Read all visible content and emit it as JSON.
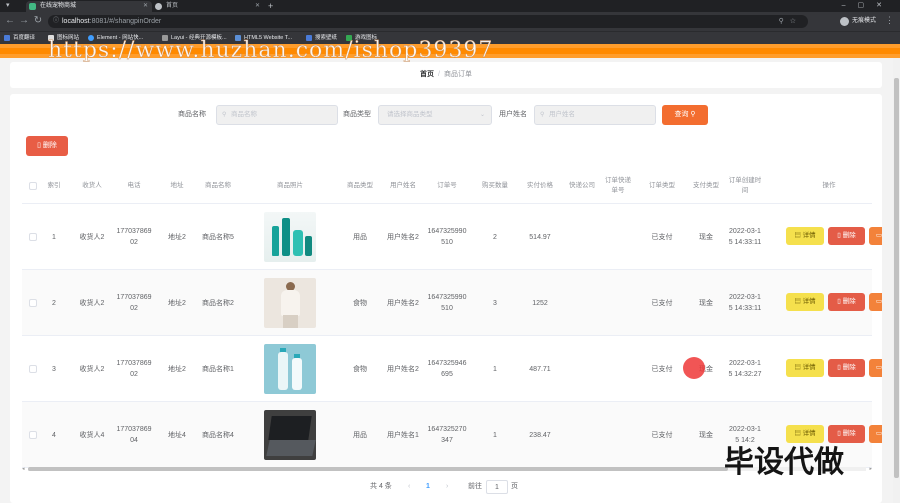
{
  "browser": {
    "tabs": [
      {
        "title": "在线宠物商城",
        "active": true
      },
      {
        "title": "首页",
        "active": false
      }
    ],
    "url_host": "localhost",
    "url_path": ":8081/#/shangpinOrder",
    "profile_label": "无痕模式",
    "bookmarks": [
      "百度翻译",
      "图标网站",
      "Element - 网站快...",
      "Layui - 经典开源模板...",
      "HTML5 Website T...",
      "搜索壁纸",
      "游戏图标"
    ]
  },
  "watermark": "https://www.huzhan.com/ishop39397",
  "breadcrumb": {
    "home": "首页",
    "separator": "/",
    "current": "商品订单"
  },
  "filters": {
    "product_name_label": "商品名称",
    "product_name_placeholder": "商品名称",
    "product_type_label": "商品类型",
    "product_type_placeholder": "请选择商品类型",
    "user_name_label": "用户姓名",
    "user_name_placeholder": "用户姓名",
    "search_button": "查询"
  },
  "actions": {
    "delete_button": "删除"
  },
  "table": {
    "columns": [
      "索引",
      "收货人",
      "电话",
      "地址",
      "商品名称",
      "商品照片",
      "商品类型",
      "用户姓名",
      "订单号",
      "购买数量",
      "实付价格",
      "快递公司",
      "订单快递单号",
      "订单类型",
      "支付类型",
      "订单创建时间",
      "操作"
    ],
    "rows": [
      {
        "index": "1",
        "receiver": "收货人2",
        "phone": "17703786902",
        "address": "地址2",
        "product_name": "商品名称5",
        "type": "用品",
        "user": "用户姓名2",
        "order_no": "1647325990510",
        "qty": "2",
        "price": "514.97",
        "courier": "",
        "tracking": "",
        "order_type": "已支付",
        "pay_type": "现金",
        "created": "2022-03-15 14:33:11",
        "image": "cosmetics-bottles"
      },
      {
        "index": "2",
        "receiver": "收货人2",
        "phone": "17703786902",
        "address": "地址2",
        "product_name": "商品名称2",
        "type": "食物",
        "user": "用户姓名2",
        "order_no": "1647325990510",
        "qty": "3",
        "price": "1252",
        "courier": "",
        "tracking": "",
        "order_type": "已支付",
        "pay_type": "现金",
        "created": "2022-03-15 14:33:11",
        "image": "woman-portrait"
      },
      {
        "index": "3",
        "receiver": "收货人2",
        "phone": "17703786902",
        "address": "地址2",
        "product_name": "商品名称1",
        "type": "食物",
        "user": "用户姓名2",
        "order_no": "1647325946695",
        "qty": "1",
        "price": "487.71",
        "courier": "",
        "tracking": "",
        "order_type": "已支付",
        "pay_type": "现金",
        "created": "2022-03-15 14:32:27",
        "image": "bottles-teal"
      },
      {
        "index": "4",
        "receiver": "收货人4",
        "phone": "17703786904",
        "address": "地址4",
        "product_name": "商品名称4",
        "type": "用品",
        "user": "用户姓名1",
        "order_no": "1647325270347",
        "qty": "1",
        "price": "238.47",
        "courier": "",
        "tracking": "",
        "order_type": "已支付",
        "pay_type": "现金",
        "created": "2022-03-15 14:2",
        "image": "laptop"
      }
    ],
    "row_buttons": {
      "detail": "详情",
      "delete": "删除",
      "edit": "修"
    }
  },
  "pagination": {
    "total": "共 4 条",
    "current_page": "1",
    "goto_label": "前往",
    "goto_value": "1",
    "page_unit": "页"
  },
  "stamp_text": "毕设代做",
  "colors": {
    "accent": "#ff8a00",
    "search_btn": "#f36d2f",
    "danger": "#e45c47",
    "detail": "#f5e04d"
  }
}
